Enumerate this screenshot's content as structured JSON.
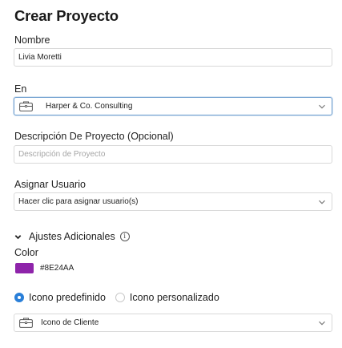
{
  "title": "Crear Proyecto",
  "nombre": {
    "label": "Nombre",
    "value": "Livia Moretti"
  },
  "en": {
    "label": "En",
    "value": "Harper & Co. Consulting"
  },
  "descripcion": {
    "label": "Descripción De Proyecto (Opcional)",
    "placeholder": "Descripción de Proyecto"
  },
  "asignar": {
    "label": "Asignar Usuario",
    "value": "Hacer clic para asignar usuario(s)"
  },
  "ajustes": {
    "label": "Ajustes Adicionales",
    "info_glyph": "i"
  },
  "color": {
    "label": "Color",
    "value": "#8E24AA",
    "swatch": "#8E24AA"
  },
  "icono": {
    "option_predefinido": "Icono predefinido",
    "option_personalizado": "Icono personalizado",
    "selected": "Icono predefinido",
    "value": "Icono de Cliente"
  },
  "colors": {
    "accent": "#2a7fd8",
    "focus_border": "#6f9fd0",
    "border": "#d9d9d9"
  },
  "icons": [
    "briefcase-icon",
    "chevron-down-icon",
    "info-icon",
    "caret-down-icon"
  ]
}
